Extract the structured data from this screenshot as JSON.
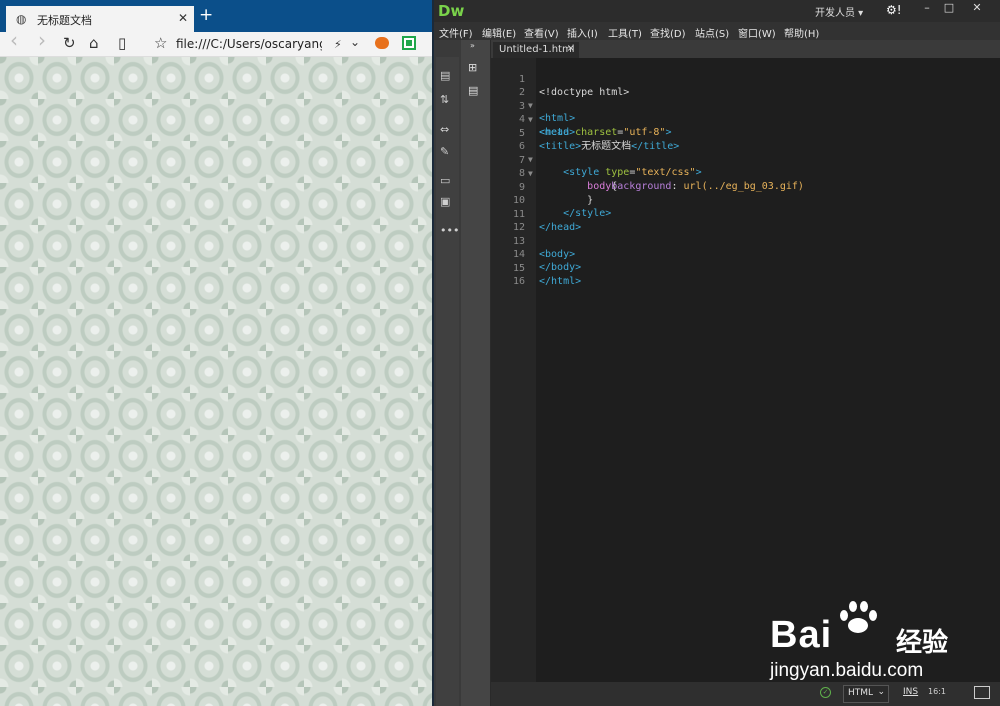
{
  "browser": {
    "tab_title": "无标题文档",
    "tab_close": "✕",
    "new_tab": "+",
    "url": "file:///C:/Users/oscaryang/De",
    "back": "‹",
    "forward": "›",
    "refresh": "↻",
    "home": "⌂",
    "reading": "▯",
    "favorite": "☆",
    "flash": "⚡",
    "dropdown": "⌄"
  },
  "dreamweaver": {
    "logo": "Dw",
    "workspace": "开发人员 ▾",
    "gear": "⚙!",
    "window": {
      "minimize": "–",
      "maximize": "□",
      "close": "✕"
    },
    "menu": [
      "文件(F)",
      "编辑(E)",
      "查看(V)",
      "插入(I)",
      "工具(T)",
      "查找(D)",
      "站点(S)",
      "窗口(W)",
      "帮助(H)"
    ],
    "tab": {
      "name": "Untitled-1.html",
      "close": "×"
    },
    "panel_toggle": "»",
    "line_numbers": [
      "1",
      "2",
      "3",
      "4",
      "5",
      "6",
      "7",
      "8",
      "9",
      "10",
      "11",
      "12",
      "13",
      "14",
      "15",
      "16"
    ],
    "code": {
      "l1": "<!doctype html>",
      "l2": "<html>",
      "l3": "<head>",
      "l4_tag_open": "<meta ",
      "l4_attr": "charset",
      "l4_eq": "=",
      "l4_val": "\"utf-8\"",
      "l4_close": ">",
      "l5_open": "<title>",
      "l5_text": "无标题文档",
      "l5_close": "</title>",
      "l6_indent": "    ",
      "l6_tag_open": "<style ",
      "l6_attr": "type",
      "l6_eq": "=",
      "l6_val": "\"text/css\"",
      "l6_close": ">",
      "l7_indent": "        ",
      "l7_sel": "body",
      "l7_brace": "{",
      "l8_indent": "            ",
      "l8_prop": "background",
      "l8_colon": ": ",
      "l8_val": "url(../eg_bg_03.gif)",
      "l9": "        }",
      "l10": "    </style>",
      "l11": "</head>",
      "l13": "<body>",
      "l14": "</body>",
      "l15": "</html>"
    },
    "status": {
      "mode": "HTML",
      "mode_arrow": "⌄",
      "ins": "INS",
      "position": "16:1",
      "ok": "✓"
    }
  },
  "watermark": {
    "brand": "Bai  ",
    "cn": "经验",
    "url": "jingyan.baidu.com"
  }
}
